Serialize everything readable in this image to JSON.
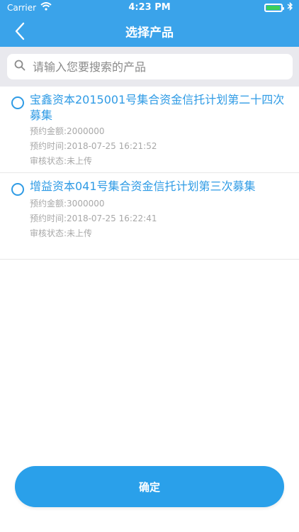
{
  "status": {
    "carrier": "Carrier",
    "time": "4:23 PM",
    "battery_level": 0.95,
    "colors": {
      "battery": "#3ccf5a"
    }
  },
  "nav": {
    "title": "选择产品",
    "back_icon": "chevron-left-icon"
  },
  "search": {
    "placeholder": "请输入您要搜索的产品",
    "value": ""
  },
  "products": [
    {
      "title": "宝鑫资本2015001号集合资金信托计划第二十四次募集",
      "amount_label": "预约金额:2000000",
      "time_label": "预约时间:2018-07-25 16:21:52",
      "status_label": "审核状态:未上传"
    },
    {
      "title": "增益资本041号集合资金信托计划第三次募集",
      "amount_label": "预约金额:3000000",
      "time_label": "预约时间:2018-07-25 16:22:41",
      "status_label": "审核状态:未上传"
    }
  ],
  "actions": {
    "confirm_label": "确定"
  },
  "colors": {
    "nav_bg": "#3aa3ea",
    "accent": "#2f9be5",
    "button_bg": "#2aa0ea",
    "meta_text": "#a8a8a8"
  }
}
